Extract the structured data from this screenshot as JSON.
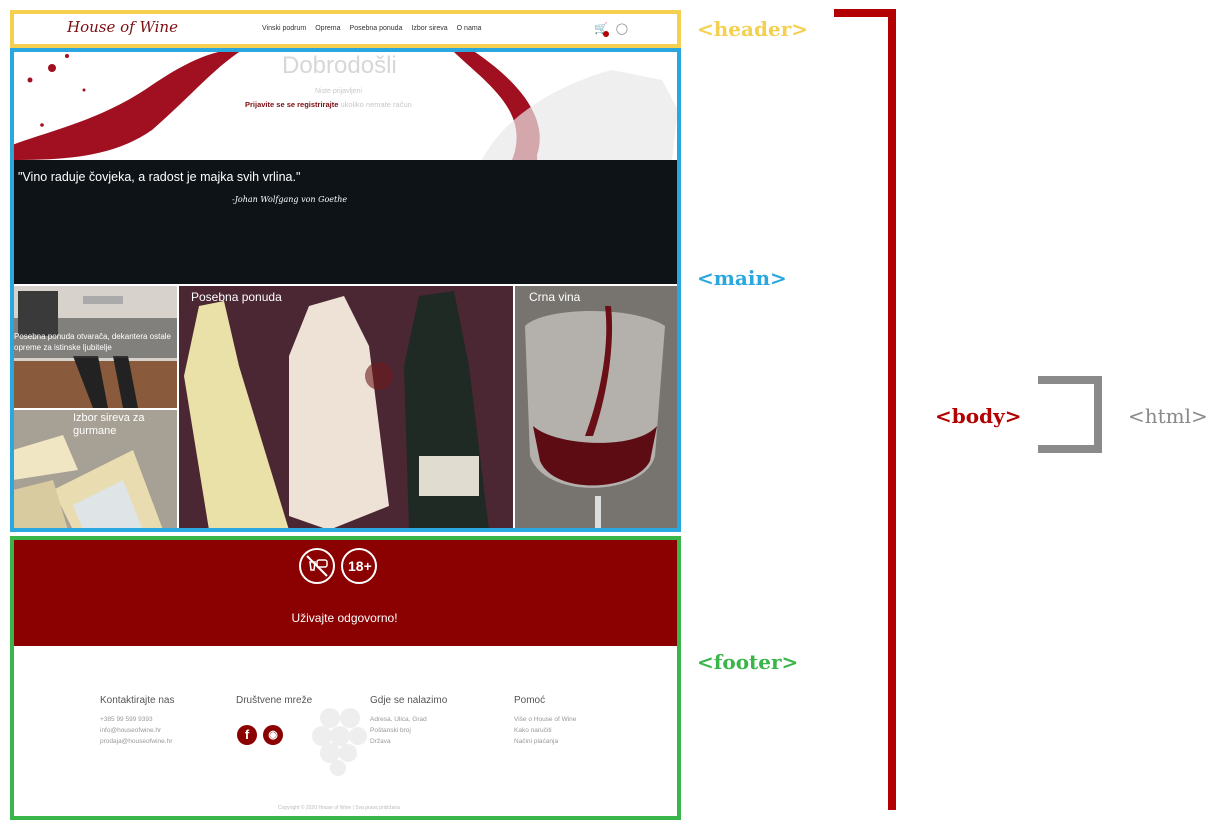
{
  "header": {
    "logo": "House of Wine",
    "nav": [
      "Vinski podrum",
      "Oprema",
      "Posebna ponuda",
      "Izbor sireva",
      "O nama"
    ]
  },
  "hero": {
    "welcome": "Dobrodošli",
    "not_logged": "Niste prijavljeni",
    "login_link": "Prijavite se",
    "register_link": "se registrirajte",
    "register_suffix": "ukoliko nemate račun",
    "quote": "\"Vino raduje čovjeka, a radost je majka svih vrlina.\"",
    "quote_author": "-Johan Wolfgang von Goethe"
  },
  "tiles": {
    "equipment_text": "Posebna ponuda otvarača, dekantera ostale opreme za istinske ljubitelje",
    "cheese": "Izbor sireva za gurmane",
    "special": "Posebna ponuda",
    "red_wines": "Crna vina"
  },
  "banner": {
    "age_badge": "18+",
    "slogan": "Uživajte odgovorno!"
  },
  "footer": {
    "contact_title": "Kontaktirajte nas",
    "contact_lines": [
      "+385 99 599 9393",
      "info@houseofwine.hr",
      "prodaja@houseofwine.hr"
    ],
    "social_title": "Društvene mreže",
    "location_title": "Gdje se nalazimo",
    "location_lines": [
      "Adresa, Ulica, Grad",
      "Poštanski broj",
      "Država"
    ],
    "help_title": "Pomoć",
    "help_lines": [
      "Više o House of Wine",
      "Kako naručiti",
      "Načini plaćanja"
    ],
    "copyright": "Copyright © 2020 House of Wine | Sva prava pridržana"
  },
  "labels": {
    "header": "<header>",
    "main": "<main>",
    "footer": "<footer>",
    "body": "<body>",
    "html": "<html>"
  },
  "colors": {
    "header": "#f5cf4f",
    "main": "#2aa7df",
    "footer": "#39b54a",
    "body": "#b30000",
    "html": "#8a8a8a",
    "wine": "#8b0000"
  }
}
